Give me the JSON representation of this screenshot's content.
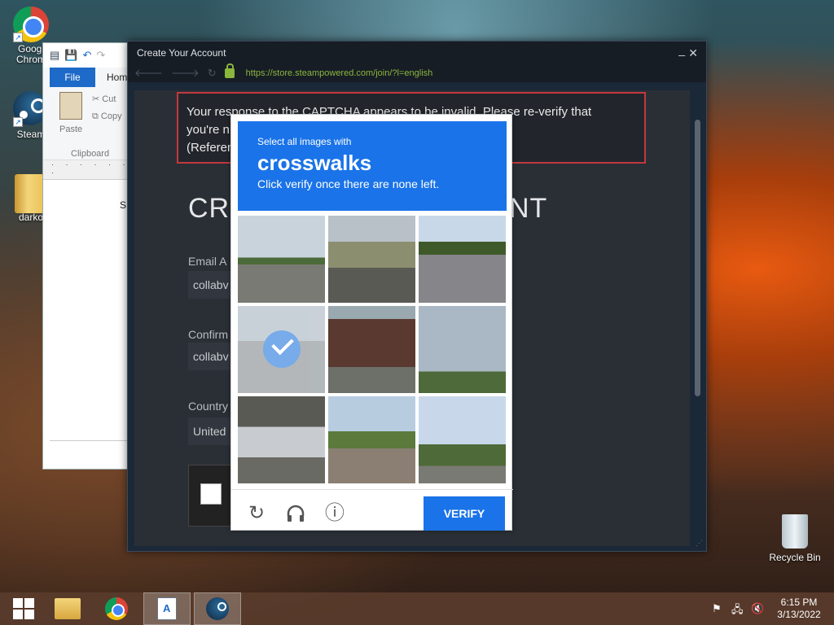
{
  "desktop": {
    "icons": [
      {
        "label": "Googl\nChrom",
        "name": "chrome"
      },
      {
        "label": "Steam",
        "name": "steam"
      },
      {
        "label": "darko",
        "name": "folder"
      }
    ],
    "recycle_bin": "Recycle Bin"
  },
  "wordpad": {
    "file_tab": "File",
    "home_tab": "Home",
    "paste": "Paste",
    "cut": "Cut",
    "copy": "Copy",
    "clipboard": "Clipboard",
    "doc_text": "S"
  },
  "steam_window": {
    "title": "Create Your Account",
    "minimize": "_",
    "close": "✕",
    "url": "https://store.steampowered.com/join/?l=english",
    "error_line1": "Your response to the CAPTCHA appears to be invalid. Please re-verify that",
    "error_line2": "you're n",
    "error_line3": "(Referen",
    "heading_start": "CR",
    "heading_end": "NT",
    "email_label": "Email A",
    "email_value": "collabv",
    "confirm_label": "Confirm",
    "confirm_value": "collabv",
    "country_label": "Country",
    "country_value": "United"
  },
  "captcha": {
    "instruction_small": "Select all images with",
    "target": "crosswalks",
    "instruction_sub": "Click verify once there are none left.",
    "verify_label": "VERIFY",
    "reload_icon": "↻",
    "audio_icon": "🎧",
    "info_icon": "ⓘ",
    "tiles_selected": [
      false,
      false,
      false,
      true,
      false,
      false,
      false,
      false,
      false
    ]
  },
  "taskbar": {
    "time": "6:15 PM",
    "date": "3/13/2022"
  },
  "colors": {
    "captcha_blue": "#1a73e8",
    "error_border": "#c1393f",
    "url_green": "#8ab63c"
  }
}
